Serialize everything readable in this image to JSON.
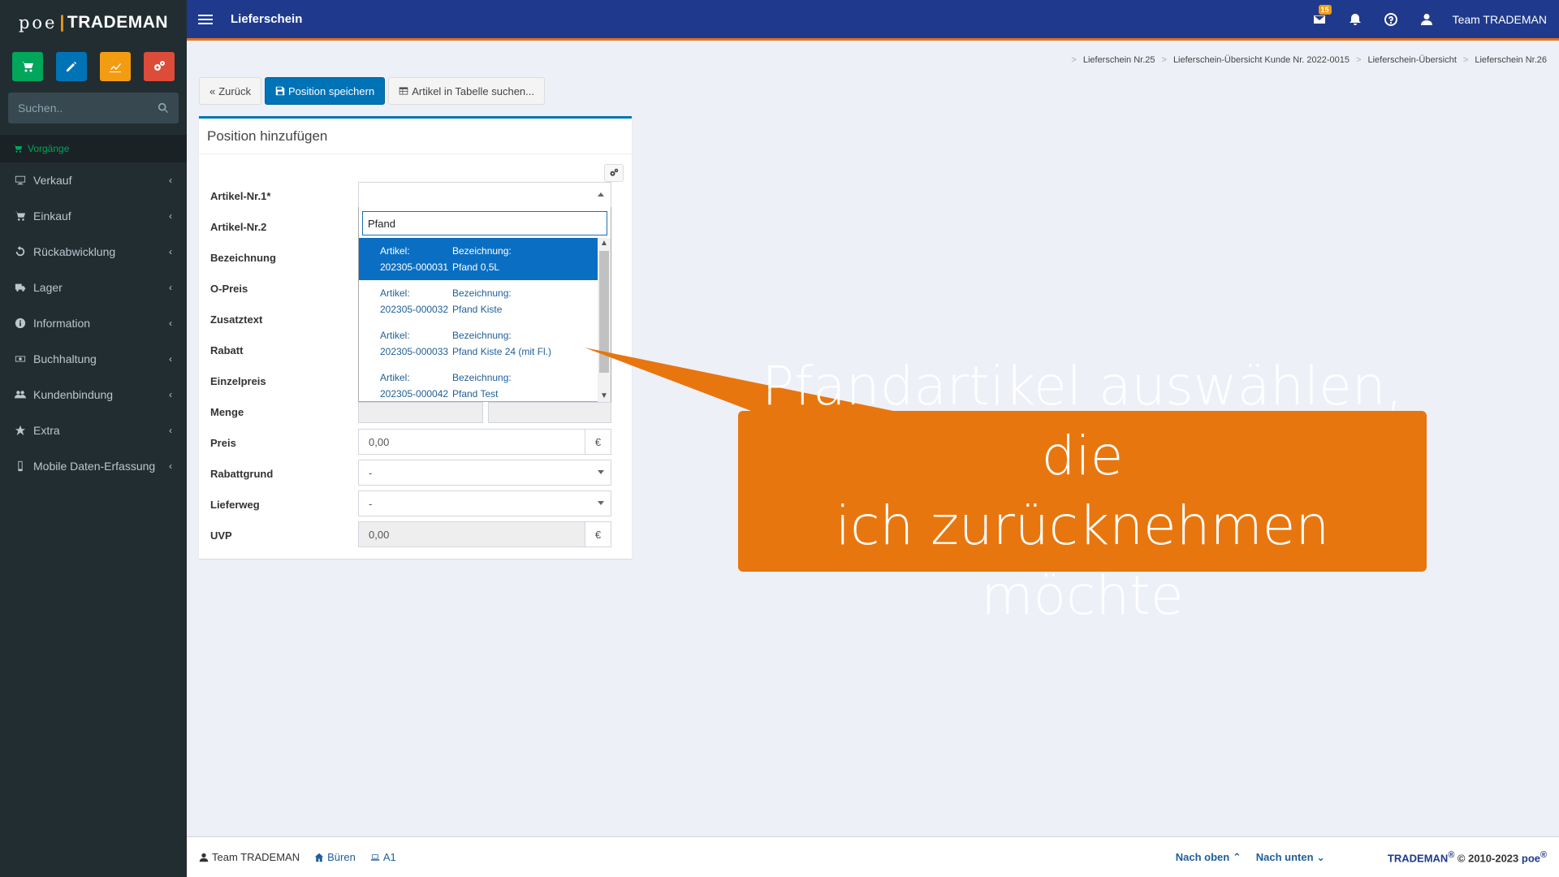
{
  "app": {
    "logo_left": "poe",
    "logo_sep": "|",
    "logo_right": "TRADEMAN",
    "page_title": "Lieferschein",
    "user": "Team TRADEMAN",
    "mail_badge": "15"
  },
  "sidebar": {
    "search_placeholder": "Suchen..",
    "section": "Vorgänge",
    "items": [
      {
        "label": "Verkauf",
        "icon": "desktop-icon"
      },
      {
        "label": "Einkauf",
        "icon": "cart-icon"
      },
      {
        "label": "Rückabwicklung",
        "icon": "undo-icon"
      },
      {
        "label": "Lager",
        "icon": "truck-icon"
      },
      {
        "label": "Information",
        "icon": "info-icon"
      },
      {
        "label": "Buchhaltung",
        "icon": "money-icon"
      },
      {
        "label": "Kundenbindung",
        "icon": "users-icon"
      },
      {
        "label": "Extra",
        "icon": "star-icon"
      },
      {
        "label": "Mobile Daten-Erfassung",
        "icon": "mobile-icon"
      }
    ],
    "quick_colors": {
      "green": "#00a65a",
      "blue": "#0073b7",
      "orange": "#f39c12",
      "red": "#dd4b39"
    }
  },
  "breadcrumb": [
    "Lieferschein Nr.25",
    "Lieferschein-Übersicht Kunde Nr. 2022-0015",
    "Lieferschein-Übersicht",
    "Lieferschein Nr.26"
  ],
  "toolbar": {
    "back": "Zurück",
    "save": "Position speichern",
    "search_table": "Artikel in Tabelle suchen..."
  },
  "form": {
    "title": "Position hinzufügen",
    "labels": {
      "artnr1": "Artikel-Nr.1*",
      "artnr2": "Artikel-Nr.2",
      "bezeichnung": "Bezeichnung",
      "opreis": "O-Preis",
      "zusatztext": "Zusatztext",
      "rabatt": "Rabatt",
      "einzelpreis": "Einzelpreis",
      "menge": "Menge",
      "preis": "Preis",
      "rabattgrund": "Rabattgrund",
      "lieferweg": "Lieferweg",
      "uvp": "UVP"
    },
    "values": {
      "preis": "0,00",
      "rabattgrund": "-",
      "lieferweg": "-",
      "uvp": "0,00",
      "currency": "€"
    }
  },
  "dropdown": {
    "search_value": "Pfand",
    "col_artikel": "Artikel:",
    "col_bez": "Bezeichnung:",
    "items": [
      {
        "artikel": "202305-000031",
        "bez": "Pfand 0,5L",
        "selected": true
      },
      {
        "artikel": "202305-000032",
        "bez": "Pfand Kiste",
        "selected": false
      },
      {
        "artikel": "202305-000033",
        "bez": "Pfand Kiste 24 (mit Fl.)",
        "selected": false
      },
      {
        "artikel": "202305-000042",
        "bez": "Pfand Test",
        "selected": false
      }
    ]
  },
  "callout": {
    "line1": "Pfandartikel auswählen, die",
    "line2": "ich zurücknehmen möchte",
    "color": "#e8760e"
  },
  "footer": {
    "user": "Team TRADEMAN",
    "location": "Büren",
    "device": "A1",
    "up": "Nach oben",
    "down": "Nach unten",
    "brand": "TRADEMAN",
    "reg": "®",
    "copyright": " © 2010-2023 ",
    "brand2": "poe",
    "reg2": "®"
  }
}
